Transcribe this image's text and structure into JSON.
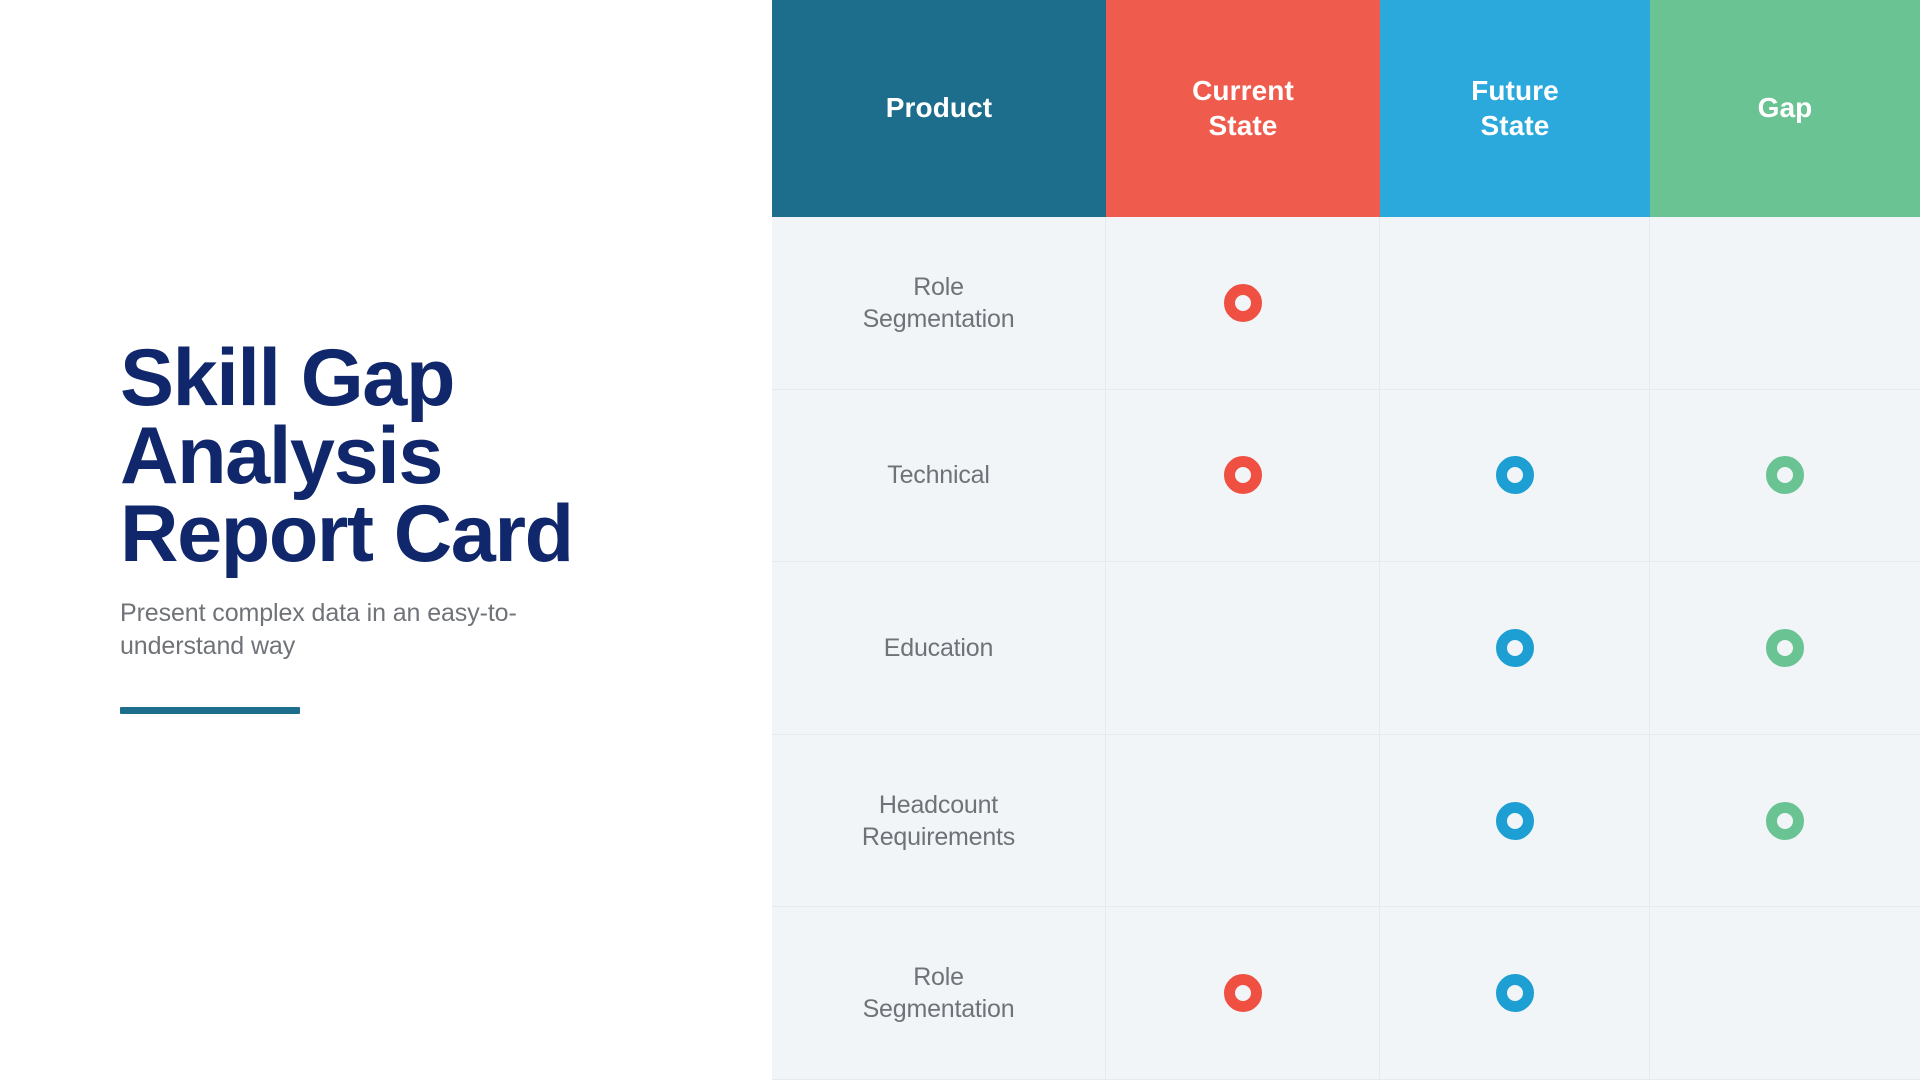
{
  "left": {
    "title": "Skill Gap\nAnalysis\nReport Card",
    "subtitle": "Present complex data in an easy-to-understand way",
    "accent_color": "#1D6E8C",
    "title_color": "#10276B",
    "subtitle_color": "#6F7378"
  },
  "table": {
    "headers": [
      {
        "label": "Product",
        "bg": "#1D6E8C"
      },
      {
        "label": "Current\nState",
        "bg": "#EF5B4C"
      },
      {
        "label": "Future\nState",
        "bg": "#2BA8DC"
      },
      {
        "label": "Gap",
        "bg": "#6AC392"
      }
    ],
    "row_bg": "#F1F5F8",
    "rows": [
      {
        "product": "Role\nSegmentation",
        "current": "red-ring-marker",
        "future": "none",
        "gap": "none"
      },
      {
        "product": "Technical",
        "current": "red-ring-marker",
        "future": "blue-ring-marker",
        "gap": "green-ring-marker"
      },
      {
        "product": "Education",
        "current": "none",
        "future": "blue-ring-marker",
        "gap": "green-ring-marker"
      },
      {
        "product": "Headcount\nRequirements",
        "current": "none",
        "future": "blue-ring-marker",
        "gap": "green-ring-marker"
      },
      {
        "product": "Role\nSegmentation",
        "current": "red-ring-marker",
        "future": "blue-ring-marker",
        "gap": "none"
      }
    ]
  }
}
